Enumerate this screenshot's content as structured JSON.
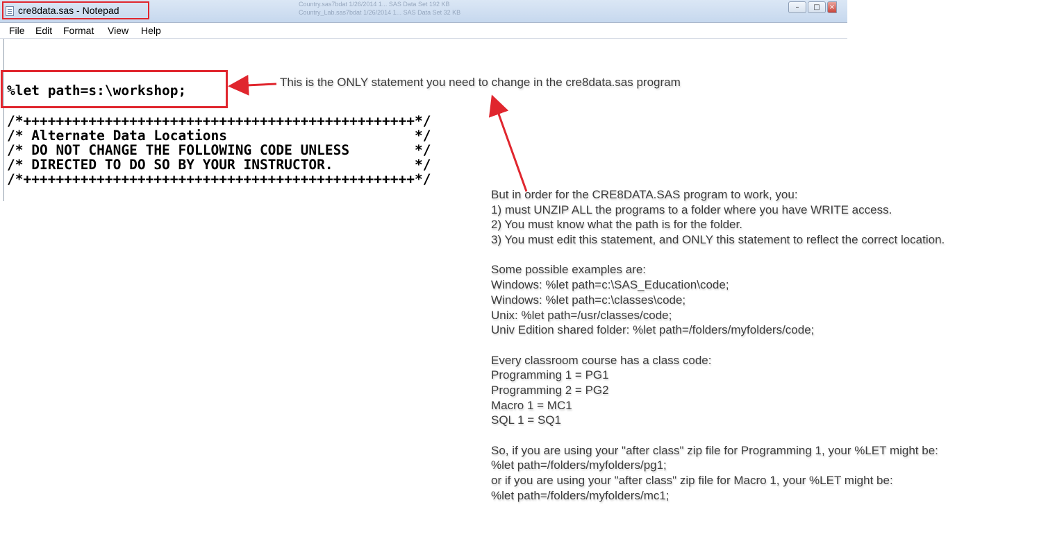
{
  "window": {
    "title": "cre8data.sas - Notepad",
    "background_files": [
      "Country.sas7bdat   1/26/2014 1...   SAS Data Set   192 KB",
      "Country_Lab.sas7bdat   1/26/2014 1...   SAS Data Set   32 KB"
    ],
    "controls": {
      "minimize": "–",
      "maximize": "□",
      "close": "×"
    }
  },
  "menu": [
    "File",
    "Edit",
    "Format",
    "View",
    "Help"
  ],
  "code": {
    "let_statement": "%let path=s:\\workshop;",
    "comment_lines": [
      "/*++++++++++++++++++++++++++++++++++++++++++++++++*/",
      "/* Alternate Data Locations                       */",
      "/* DO NOT CHANGE THE FOLLOWING CODE UNLESS        */",
      "/* DIRECTED TO DO SO BY YOUR INSTRUCTOR.          */",
      "/*++++++++++++++++++++++++++++++++++++++++++++++++*/"
    ]
  },
  "annotations": {
    "top_note": "This is the ONLY statement you need to change in the cre8data.sas program",
    "instructions": [
      "But in order for the CRE8DATA.SAS program to work, you:",
      "1) must UNZIP ALL the programs to a folder where you have WRITE access.",
      "2) You must know what the path is for the folder.",
      "3) You must edit this statement, and ONLY this statement to reflect the correct location.",
      "",
      "Some possible examples are:",
      "Windows: %let path=c:\\SAS_Education\\code;",
      "Windows: %let path=c:\\classes\\code;",
      "Unix: %let path=/usr/classes/code;",
      "Univ Edition shared folder: %let path=/folders/myfolders/code;",
      "",
      "Every classroom course has a class code:",
      "Programming 1 = PG1",
      "Programming 2 = PG2",
      "Macro 1 = MC1",
      "SQL 1 = SQ1",
      "",
      "So, if you are using your \"after class\" zip file for Programming 1, your %LET might be:",
      "%let path=/folders/myfolders/pg1;",
      "or if you are using your \"after class\" zip file for Macro 1, your %LET might be:",
      "%let path=/folders/myfolders/mc1;"
    ]
  },
  "colors": {
    "highlight": "#e0262e",
    "titlebar": "#c6d8ee",
    "note_text": "#3c3c3c"
  }
}
